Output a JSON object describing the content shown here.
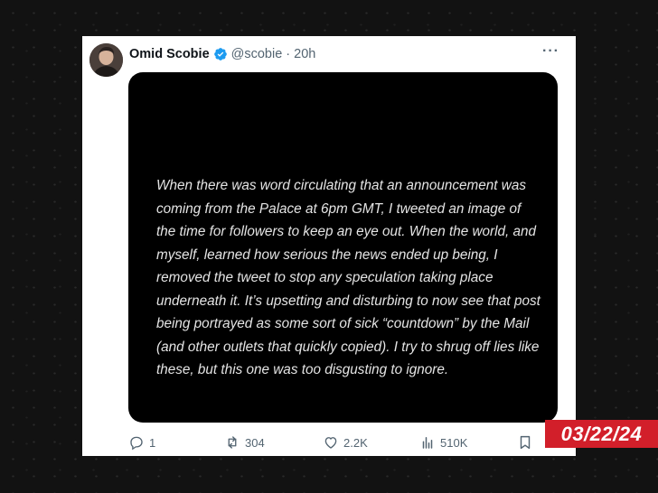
{
  "tweet": {
    "author_name": "Omid Scobie",
    "handle": "@scobie",
    "separator": "·",
    "time_ago": "20h",
    "more_label": "···",
    "statement": "When there was word circulating that an announcement was coming from the Palace at 6pm GMT, I tweeted an image of the time for followers to keep an eye out. When the world, and myself, learned how serious the news ended up being, I removed the tweet to stop any speculation taking place underneath it. It’s upsetting and disturbing to now see that post being portrayed as some sort of sick “countdown” by the Mail (and other outlets that quickly copied). I try to shrug off lies like these, but this one was too disgusting to ignore.",
    "reply_count": "1",
    "retweet_count": "304",
    "like_count": "2.2K",
    "view_count": "510K"
  },
  "badge": {
    "date": "03/22/24"
  },
  "icons": {
    "verified": "verified-badge-icon",
    "reply": "reply-icon",
    "retweet": "retweet-icon",
    "like": "heart-icon",
    "views": "analytics-icon",
    "bookmark": "bookmark-icon"
  },
  "colors": {
    "verified": "#1d9bf0",
    "badge": "#d21f2a",
    "muted": "#536471"
  }
}
